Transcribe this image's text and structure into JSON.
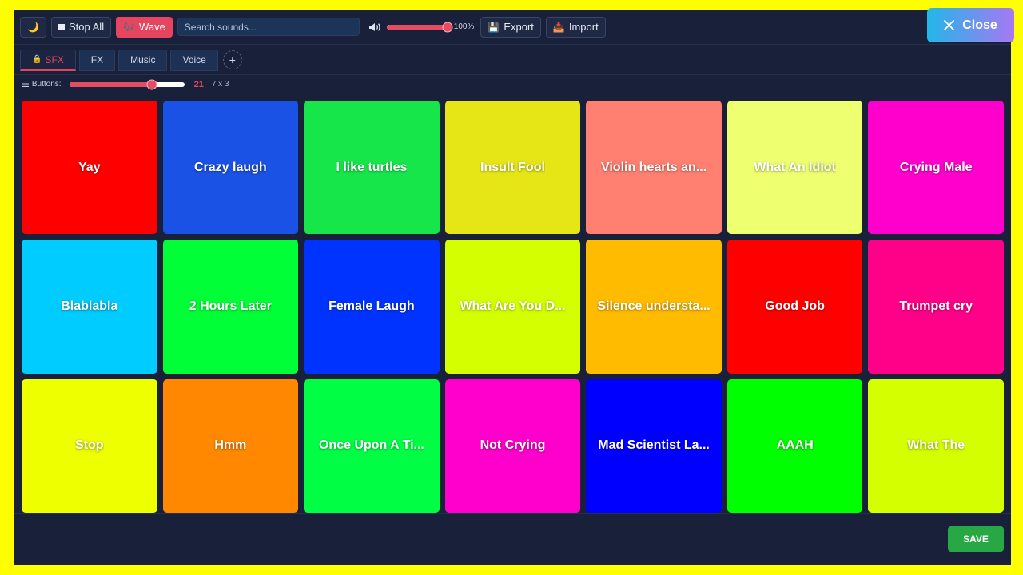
{
  "toolbar": {
    "theme_icon": "moon-icon",
    "stop_all_label": "Stop All",
    "wave_label": "Wave",
    "search_placeholder": "Search sounds...",
    "volume_percent": 100,
    "volume_label": "100%",
    "export_label": "Export",
    "import_label": "Import"
  },
  "close_label": "Close",
  "tabs": [
    {
      "label": "SFX",
      "active": true,
      "icon": "lock-icon"
    },
    {
      "label": "FX",
      "active": false
    },
    {
      "label": "Music",
      "active": false
    },
    {
      "label": "Voice",
      "active": false
    }
  ],
  "add_tab_label": "+",
  "buttons_bar": {
    "label": "Buttons:",
    "count": "21",
    "count_value": 21,
    "slider_fraction": 0.72,
    "grid_dims": "7 x 3"
  },
  "pads": [
    {
      "label": "Yay",
      "color": "#ff0000"
    },
    {
      "label": "Crazy laugh",
      "color": "#1a52e6"
    },
    {
      "label": "I like turtles",
      "color": "#16e64a"
    },
    {
      "label": "Insult Fool",
      "color": "#e6e617"
    },
    {
      "label": "Violin hearts an...",
      "color": "#ff7f70"
    },
    {
      "label": "What An Idiot",
      "color": "#eeff70"
    },
    {
      "label": "Crying Male",
      "color": "#ff00cc"
    },
    {
      "label": "Blablabla",
      "color": "#00ccff"
    },
    {
      "label": "2 Hours Later",
      "color": "#00ff37"
    },
    {
      "label": "Female Laugh",
      "color": "#0033ff"
    },
    {
      "label": "What Are You D...",
      "color": "#d4ff00"
    },
    {
      "label": "Silence understa...",
      "color": "#ffbb00"
    },
    {
      "label": "Good Job",
      "color": "#ff0000"
    },
    {
      "label": "Trumpet cry",
      "color": "#ff0088"
    },
    {
      "label": "Stop",
      "color": "#eeff00"
    },
    {
      "label": "Hmm",
      "color": "#ff8800"
    },
    {
      "label": "Once Upon A Ti...",
      "color": "#00ff44"
    },
    {
      "label": "Not Crying",
      "color": "#ff00cc"
    },
    {
      "label": "Mad Scientist La...",
      "color": "#0000ff"
    },
    {
      "label": "AAAH",
      "color": "#00ff00"
    },
    {
      "label": "What The",
      "color": "#d4ff00"
    }
  ],
  "save_label": "SAVE",
  "colors": {
    "accent": "#e6455f",
    "background": "#19213a",
    "save": "#28a745"
  }
}
